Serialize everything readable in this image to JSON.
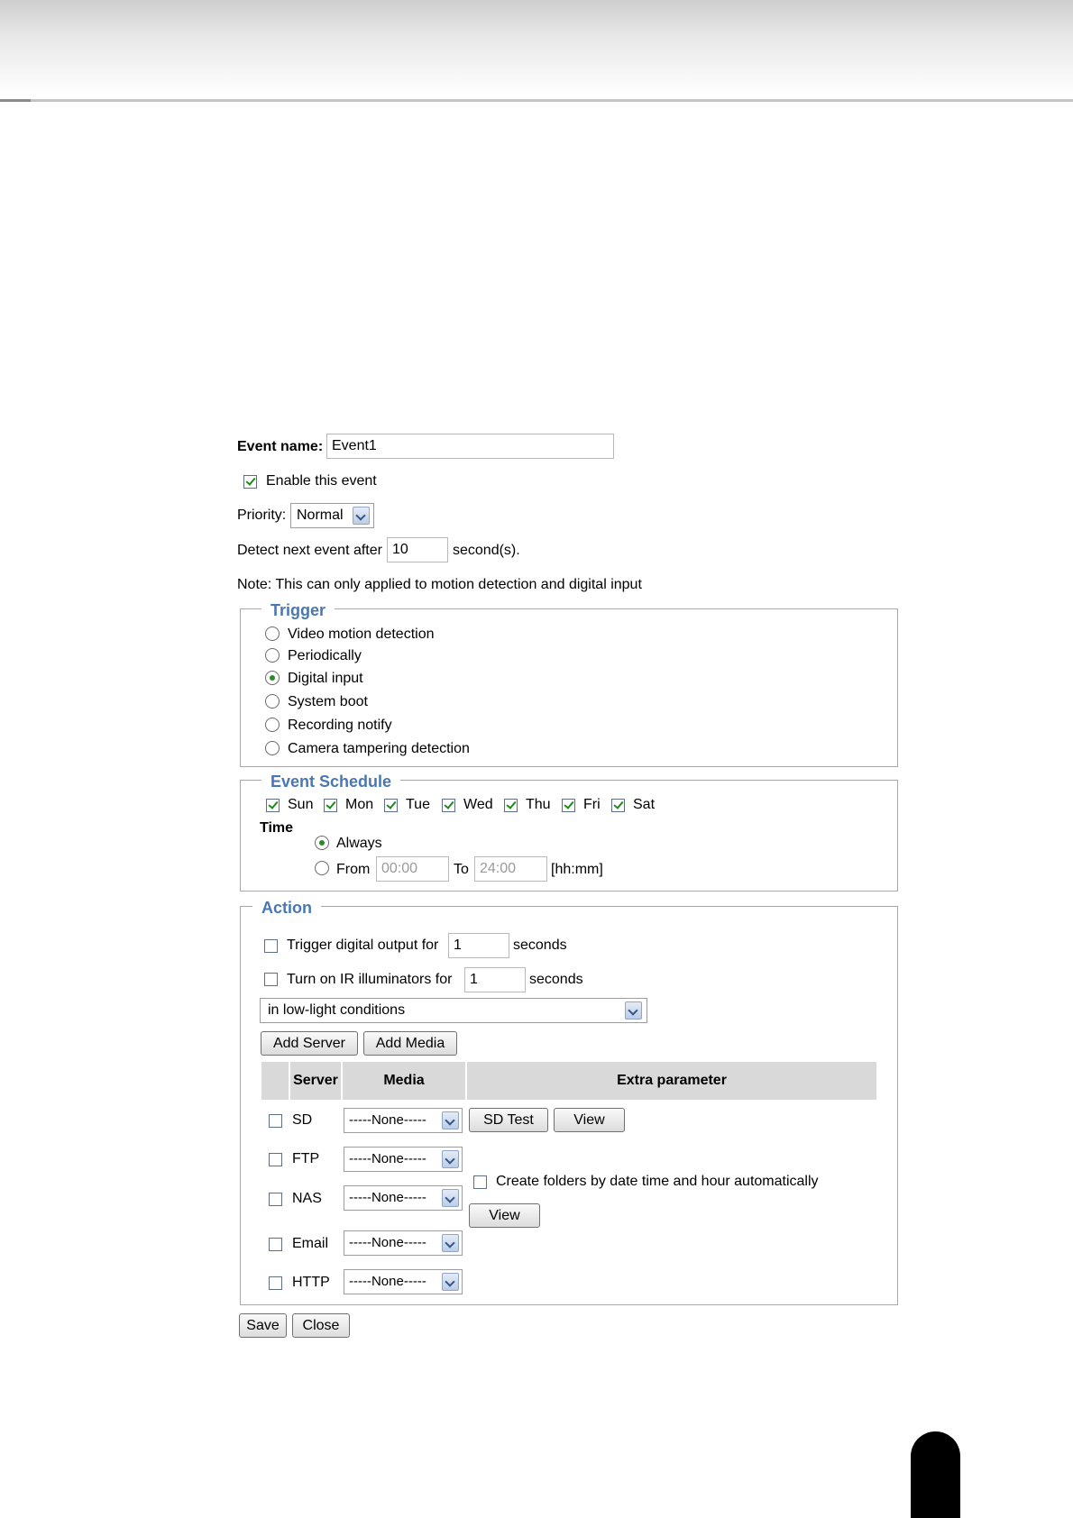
{
  "event_name": {
    "label": "Event name:",
    "value": "Event1"
  },
  "enable": {
    "label": "Enable this event",
    "checked": true
  },
  "priority": {
    "label": "Priority:",
    "value": "Normal"
  },
  "detect": {
    "label": "Detect next event after",
    "value": "10",
    "unit": "second(s)."
  },
  "note": "Note: This can only applied to motion detection and digital input",
  "trigger": {
    "legend": "Trigger",
    "options": [
      {
        "label": "Video motion detection",
        "selected": false
      },
      {
        "label": "Periodically",
        "selected": false
      },
      {
        "label": "Digital input",
        "selected": true
      },
      {
        "label": "System boot",
        "selected": false
      },
      {
        "label": "Recording notify",
        "selected": false
      },
      {
        "label": "Camera tampering detection",
        "selected": false
      }
    ]
  },
  "schedule": {
    "legend": "Event Schedule",
    "days": [
      {
        "label": "Sun",
        "checked": true
      },
      {
        "label": "Mon",
        "checked": true
      },
      {
        "label": "Tue",
        "checked": true
      },
      {
        "label": "Wed",
        "checked": true
      },
      {
        "label": "Thu",
        "checked": true
      },
      {
        "label": "Fri",
        "checked": true
      },
      {
        "label": "Sat",
        "checked": true
      }
    ],
    "time_label": "Time",
    "always_label": "Always",
    "from_label": "From",
    "from_value": "00:00",
    "to_label": "To",
    "to_value": "24:00",
    "format_label": "[hh:mm]"
  },
  "action": {
    "legend": "Action",
    "digital_output": {
      "label": "Trigger digital output for",
      "value": "1",
      "unit": "seconds",
      "checked": false
    },
    "ir": {
      "label": "Turn on IR illuminators for",
      "value": "1",
      "unit": "seconds",
      "checked": false
    },
    "ir_condition": "in low-light conditions",
    "add_server_label": "Add Server",
    "add_media_label": "Add Media",
    "table": {
      "headers": [
        "Server",
        "Media",
        "Extra parameter"
      ],
      "rows": [
        {
          "server": "SD",
          "media": "-----None-----"
        },
        {
          "server": "FTP",
          "media": "-----None-----"
        },
        {
          "server": "NAS",
          "media": "-----None-----"
        },
        {
          "server": "Email",
          "media": "-----None-----"
        },
        {
          "server": "HTTP",
          "media": "-----None-----"
        }
      ],
      "sd_test_label": "SD Test",
      "view_label": "View",
      "create_folders_label": "Create folders by date time and hour automatically",
      "view2_label": "View"
    }
  },
  "footer": {
    "save_label": "Save",
    "close_label": "Close"
  }
}
